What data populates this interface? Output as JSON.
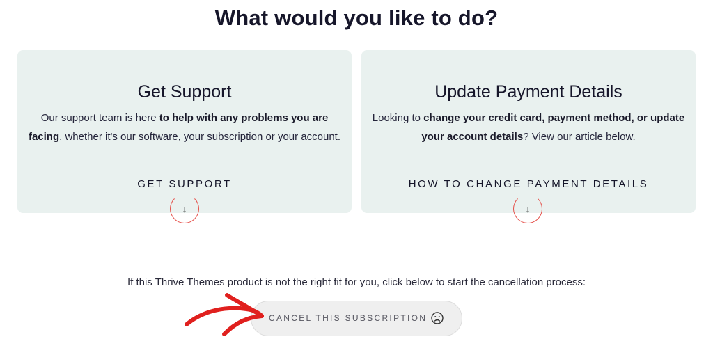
{
  "page": {
    "title": "What would you like to do?"
  },
  "cards": [
    {
      "title": "Get Support",
      "body_parts": [
        {
          "text": "Our support team is here ",
          "bold": false
        },
        {
          "text": "to help with any problems you are facing",
          "bold": true
        },
        {
          "text": ", whether it's our software, your subscription or your account.",
          "bold": false
        }
      ],
      "link_label": "GET SUPPORT",
      "arrow_glyph": "↓"
    },
    {
      "title": "Update Payment Details",
      "body_parts": [
        {
          "text": "Looking to ",
          "bold": false
        },
        {
          "text": "change your credit card, payment method, or update your account details",
          "bold": true
        },
        {
          "text": "? View our article below.",
          "bold": false
        }
      ],
      "link_label": "HOW TO CHANGE PAYMENT DETAILS",
      "arrow_glyph": "↓"
    }
  ],
  "cancellation": {
    "prompt": "If this Thrive Themes product is not the right fit for you, click below to start the cancellation process:",
    "button_label": "CANCEL THIS SUBSCRIPTION",
    "button_icon": "sad-face-icon"
  },
  "annotation": {
    "arrow_icon": "red-hand-drawn-arrow-icon",
    "color": "#e0201e"
  },
  "colors": {
    "card_background": "#e9f1ef",
    "accent_circle": "#e5504a",
    "button_background": "#efefef"
  }
}
